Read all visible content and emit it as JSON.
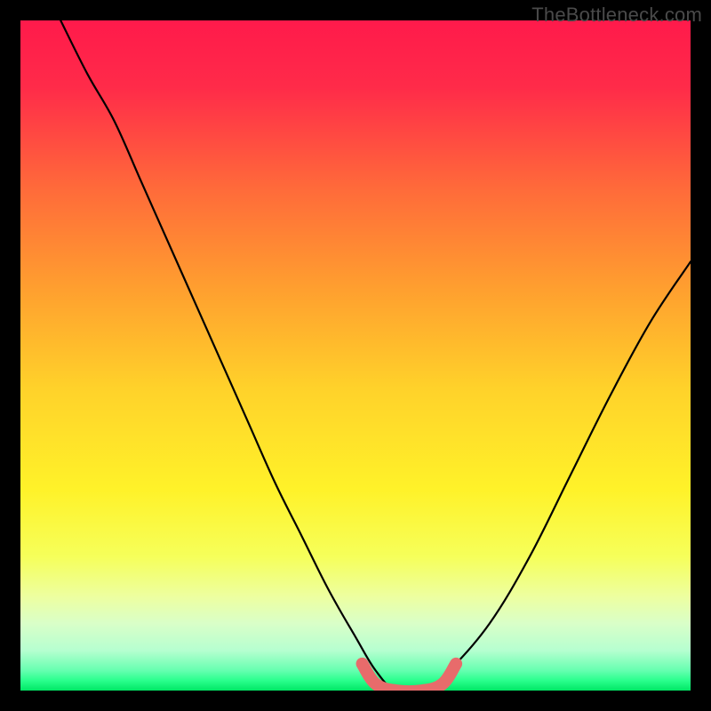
{
  "watermark": "TheBottleneck.com",
  "colors": {
    "frame_bg": "#000000",
    "curve": "#000000",
    "highlight": "#e86b6b",
    "gradient_stops": [
      {
        "offset": 0.0,
        "color": "#ff1a4b"
      },
      {
        "offset": 0.1,
        "color": "#ff2b49"
      },
      {
        "offset": 0.25,
        "color": "#ff6a3a"
      },
      {
        "offset": 0.4,
        "color": "#ff9f2f"
      },
      {
        "offset": 0.55,
        "color": "#ffd22a"
      },
      {
        "offset": 0.7,
        "color": "#fff229"
      },
      {
        "offset": 0.8,
        "color": "#f6ff5a"
      },
      {
        "offset": 0.86,
        "color": "#edffa0"
      },
      {
        "offset": 0.9,
        "color": "#d9ffc8"
      },
      {
        "offset": 0.94,
        "color": "#b6ffd0"
      },
      {
        "offset": 0.97,
        "color": "#66ffb0"
      },
      {
        "offset": 0.985,
        "color": "#2aff8d"
      },
      {
        "offset": 1.0,
        "color": "#00e765"
      }
    ]
  },
  "chart_data": {
    "type": "line",
    "title": "",
    "xlabel": "",
    "ylabel": "",
    "xlim": [
      0,
      100
    ],
    "ylim": [
      0,
      100
    ],
    "grid": false,
    "legend": false,
    "series": [
      {
        "name": "bottleneck-curve",
        "x": [
          6,
          10,
          14,
          18,
          22,
          26,
          30,
          34,
          38,
          42,
          46,
          50,
          53,
          56,
          60,
          64,
          70,
          76,
          82,
          88,
          94,
          100
        ],
        "y": [
          100,
          92,
          85,
          76,
          67,
          58,
          49,
          40,
          31,
          23,
          15,
          8,
          3,
          0,
          0,
          3,
          10,
          20,
          32,
          44,
          55,
          64
        ]
      },
      {
        "name": "optimal-range-highlight",
        "x": [
          51,
          53,
          56,
          60,
          63,
          65
        ],
        "y": [
          4,
          1,
          0,
          0,
          1,
          4
        ]
      }
    ],
    "annotations": []
  }
}
